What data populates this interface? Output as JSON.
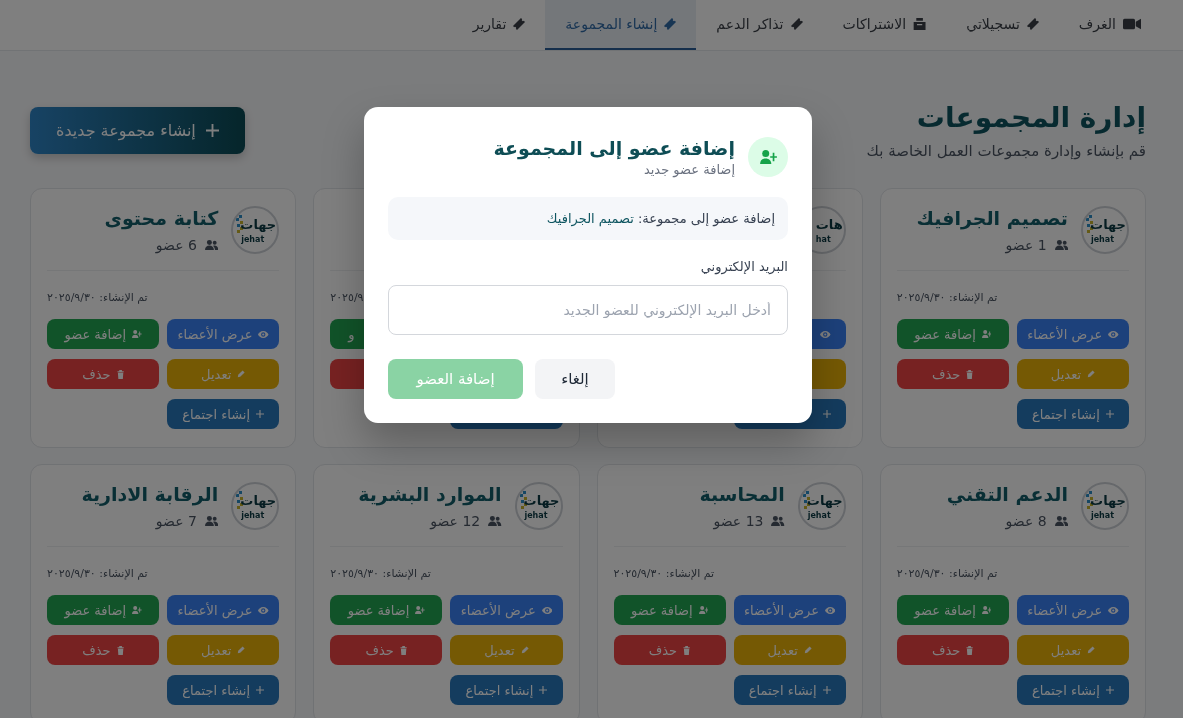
{
  "nav": {
    "tabs": [
      {
        "label": "الغرف",
        "selected": false
      },
      {
        "label": "تسجيلاتي",
        "selected": false
      },
      {
        "label": "الاشتراكات",
        "selected": false
      },
      {
        "label": "تذاكر الدعم",
        "selected": false
      },
      {
        "label": "إنشاء المجموعة",
        "selected": true
      },
      {
        "label": "تقارير",
        "selected": false
      }
    ]
  },
  "header": {
    "title": "إدارة المجموعات",
    "subtitle": "قم بإنشاء وإدارة مجموعات العمل الخاصة بك",
    "create_button": "إنشاء مجموعة جديدة"
  },
  "groups": [
    {
      "logo": {
        "wordmark": "جهات",
        "latin": "jehat"
      },
      "name": "تصميم الجرافيك",
      "members": "1 عضو",
      "created": "تم الإنشاء: ٢٠٢٥/٩/٣٠",
      "buttons": [
        {
          "kind": "view",
          "label": "عرض الأعضاء"
        },
        {
          "kind": "add",
          "label": "إضافة عضو"
        },
        {
          "kind": "edit",
          "label": "تعديل"
        },
        {
          "kind": "delete",
          "label": "حذف"
        },
        {
          "kind": "meeting",
          "label": "إنشاء اجتماع"
        }
      ]
    },
    {
      "logo": {
        "wordmark": "هات",
        "latin": "hat",
        "dots": false
      },
      "buttons": [
        {
          "kind": "view"
        },
        {
          "kind": "edit",
          "icon": false
        },
        {
          "kind": "meeting"
        }
      ]
    },
    {
      "created": "٢٠٢٥/٩",
      "buttons": [
        {
          "kind": "add",
          "icon": false,
          "label": "و"
        },
        {
          "kind": "delete",
          "icon": false
        },
        {
          "kind": "meeting",
          "icon": false
        }
      ]
    },
    {
      "logo": {
        "wordmark": "جهات",
        "latin": "jehat"
      },
      "name": "كتابة محتوى",
      "members": "6 عضو",
      "created": "تم الإنشاء: ٢٠٢٥/٩/٣٠",
      "buttons": [
        {
          "kind": "view",
          "label": "عرض الأعضاء"
        },
        {
          "kind": "add",
          "label": "إضافة عضو"
        },
        {
          "kind": "edit",
          "label": "تعديل"
        },
        {
          "kind": "delete",
          "label": "حذف"
        },
        {
          "kind": "meeting",
          "label": "إنشاء اجتماع"
        }
      ]
    },
    {
      "logo": {
        "wordmark": "جهات",
        "latin": "jehat"
      },
      "name": "الدعم التقني",
      "members": "8 عضو",
      "created": "تم الإنشاء: ٢٠٢٥/٩/٣٠",
      "buttons": [
        {
          "kind": "view",
          "label": "عرض الأعضاء"
        },
        {
          "kind": "add",
          "label": "إضافة عضو"
        },
        {
          "kind": "edit",
          "label": "تعديل"
        },
        {
          "kind": "delete",
          "label": "حذف"
        },
        {
          "kind": "meeting",
          "label": "إنشاء اجتماع"
        }
      ]
    },
    {
      "logo": {
        "wordmark": "جهات",
        "latin": "jehat"
      },
      "name": "المحاسبة",
      "members": "13 عضو",
      "created": "تم الإنشاء: ٢٠٢٥/٩/٣٠",
      "buttons": [
        {
          "kind": "view",
          "label": "عرض الأعضاء"
        },
        {
          "kind": "add",
          "label": "إضافة عضو"
        },
        {
          "kind": "edit",
          "label": "تعديل"
        },
        {
          "kind": "delete",
          "label": "حذف"
        },
        {
          "kind": "meeting",
          "label": "إنشاء اجتماع"
        }
      ]
    },
    {
      "logo": {
        "wordmark": "جهات",
        "latin": "jehat"
      },
      "name": "الموارد البشرية",
      "members": "12 عضو",
      "created": "تم الإنشاء: ٢٠٢٥/٩/٣٠",
      "buttons": [
        {
          "kind": "view",
          "label": "عرض الأعضاء"
        },
        {
          "kind": "add",
          "label": "إضافة عضو"
        },
        {
          "kind": "edit",
          "label": "تعديل"
        },
        {
          "kind": "delete",
          "label": "حذف"
        },
        {
          "kind": "meeting",
          "label": "إنشاء اجتماع"
        }
      ]
    },
    {
      "logo": {
        "wordmark": "جهات",
        "latin": "jehat"
      },
      "name": "الرقابة الادارية",
      "members": "7 عضو",
      "created": "تم الإنشاء: ٢٠٢٥/٩/٣٠",
      "buttons": [
        {
          "kind": "view",
          "label": "عرض الأعضاء"
        },
        {
          "kind": "add",
          "label": "إضافة عضو"
        },
        {
          "kind": "edit",
          "label": "تعديل"
        },
        {
          "kind": "delete",
          "label": "حذف"
        },
        {
          "kind": "meeting",
          "label": "إنشاء اجتماع"
        }
      ]
    }
  ],
  "dialog": {
    "title": "إضافة عضو إلى المجموعة",
    "subtitle": "إضافة عضو جديد",
    "info_label": "إضافة عضو إلى مجموعة:",
    "info_group": "تصميم الجرافيك",
    "email": {
      "label": "البريد الإلكتروني",
      "placeholder": "أدخل البريد الإلكتروني للعضو الجديد"
    },
    "cancel": {
      "label": "إلغاء"
    },
    "submit": {
      "label": "إضافة العضو",
      "disabled": true
    }
  }
}
